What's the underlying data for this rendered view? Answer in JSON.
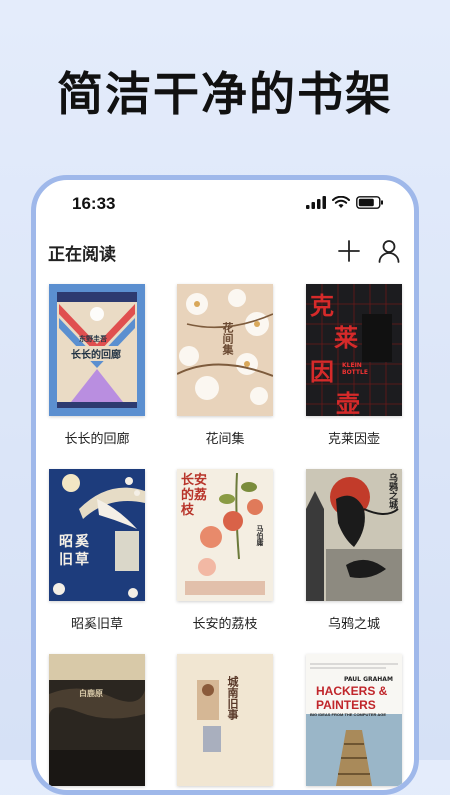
{
  "headline": "简洁干净的书架",
  "status_bar": {
    "time": "16:33"
  },
  "app_bar": {
    "title": "正在阅读"
  },
  "books": [
    {
      "title": "长长的回廊",
      "cover_text": [
        "东野圭吾",
        "长长的回廊"
      ]
    },
    {
      "title": "花间集",
      "cover_text": [
        "花间集"
      ]
    },
    {
      "title": "克莱因壶",
      "cover_text": [
        "克",
        "莱",
        "因",
        "壶",
        "KLEIN BOTTLE"
      ]
    },
    {
      "title": "昭奚旧草",
      "cover_text": [
        "昭",
        "奚",
        "旧",
        "草"
      ]
    },
    {
      "title": "长安的荔枝",
      "cover_text": [
        "长安的荔枝",
        "马伯庸"
      ]
    },
    {
      "title": "乌鸦之城",
      "cover_text": [
        "乌鸦之城"
      ]
    },
    {
      "title": "",
      "cover_text": [
        "白鹿原"
      ]
    },
    {
      "title": "",
      "cover_text": [
        "城南旧事"
      ]
    },
    {
      "title": "",
      "cover_text": [
        "PAUL GRAHAM",
        "HACKERS &",
        "PAINTERS",
        "BIG IDEAS FROM THE COMPUTER AGE"
      ]
    }
  ],
  "colors": {
    "phone_border": "#9fb8ea",
    "background": "#dbe5f8"
  }
}
